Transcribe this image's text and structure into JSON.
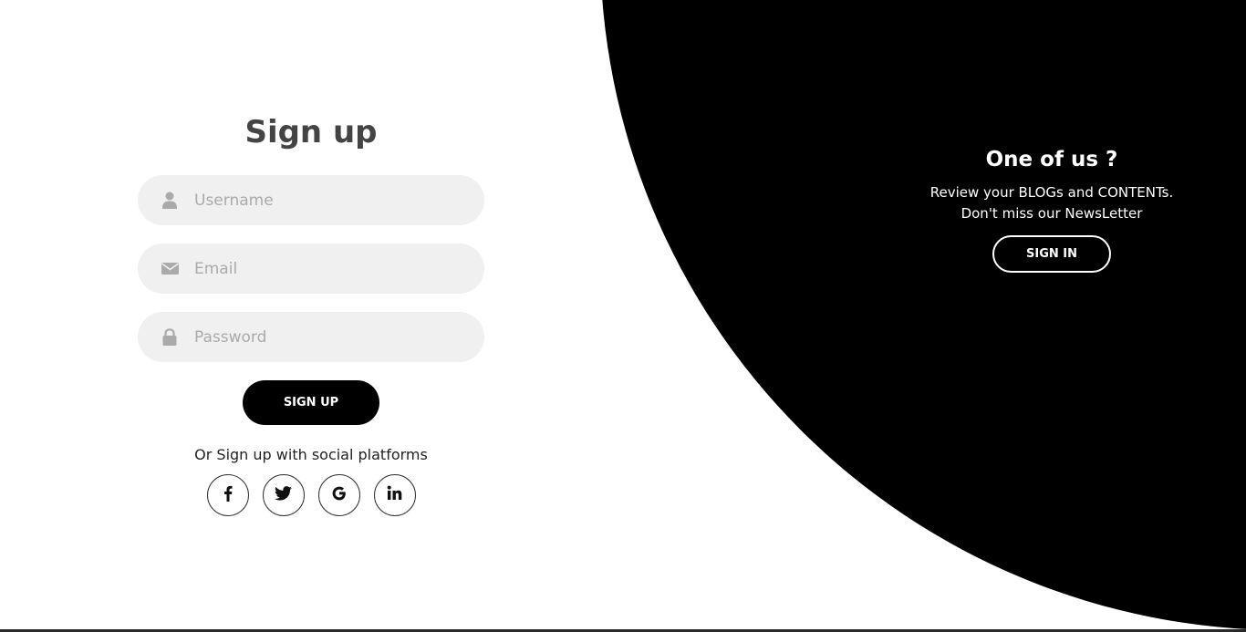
{
  "signup": {
    "title": "Sign up",
    "username_placeholder": "Username",
    "email_placeholder": "Email",
    "password_placeholder": "Password",
    "submit_label": "SIGN UP",
    "social_text": "Or Sign up with social platforms",
    "socials": [
      {
        "name": "facebook",
        "glyph": "f"
      },
      {
        "name": "twitter",
        "glyph": "twitter"
      },
      {
        "name": "google",
        "glyph": "G"
      },
      {
        "name": "linkedin",
        "glyph": "in"
      }
    ]
  },
  "panel": {
    "heading": "One of us ?",
    "line1": "Review your BLOGs and CONTENTs.",
    "line2": "Don't miss our NewsLetter",
    "signin_label": "SIGN IN"
  },
  "colors": {
    "accent": "#000000",
    "field_bg": "#f0f0f0",
    "title": "#444444",
    "placeholder": "#aaaaaa"
  },
  "icons": {
    "username": "user-icon",
    "email": "envelope-icon",
    "password": "lock-icon"
  }
}
